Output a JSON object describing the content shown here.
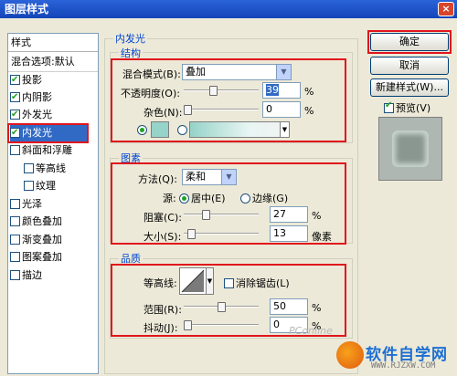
{
  "window": {
    "title": "图层样式",
    "close_label": "×"
  },
  "styles_panel": {
    "header": "样式",
    "blending_options": "混合选项:默认",
    "items": [
      {
        "label": "投影",
        "checked": true
      },
      {
        "label": "内阴影",
        "checked": true
      },
      {
        "label": "外发光",
        "checked": true
      },
      {
        "label": "内发光",
        "checked": true,
        "selected": true
      },
      {
        "label": "斜面和浮雕",
        "checked": false
      },
      {
        "label": "等高线",
        "checked": false,
        "indent": true
      },
      {
        "label": "纹理",
        "checked": false,
        "indent": true
      },
      {
        "label": "光泽",
        "checked": false
      },
      {
        "label": "颜色叠加",
        "checked": false
      },
      {
        "label": "渐变叠加",
        "checked": false
      },
      {
        "label": "图案叠加",
        "checked": false
      },
      {
        "label": "描边",
        "checked": false
      }
    ]
  },
  "inner_glow": {
    "title": "内发光",
    "structure": {
      "title": "结构",
      "blend_mode_label": "混合模式(B):",
      "blend_mode_value": "叠加",
      "opacity_label": "不透明度(O):",
      "opacity_value": "39",
      "opacity_unit": "%",
      "opacity_fraction": 0.39,
      "noise_label": "杂色(N):",
      "noise_value": "0",
      "noise_unit": "%",
      "noise_fraction": 0,
      "glow_color": "#96d3c8"
    },
    "elements": {
      "title": "图素",
      "technique_label": "方法(Q):",
      "technique_value": "柔和",
      "source_label": "源:",
      "source_center": "居中(E)",
      "source_edge": "边缘(G)",
      "choke_label": "阻塞(C):",
      "choke_value": "27",
      "choke_unit": "%",
      "choke_fraction": 0.27,
      "size_label": "大小(S):",
      "size_value": "13",
      "size_unit": "像素",
      "size_fraction": 0.05
    },
    "quality": {
      "title": "品质",
      "contour_label": "等高线:",
      "antialias_label": "消除锯齿(L)",
      "range_label": "范围(R):",
      "range_value": "50",
      "range_unit": "%",
      "range_fraction": 0.5,
      "jitter_label": "抖动(J):",
      "jitter_value": "0",
      "jitter_unit": "%",
      "jitter_fraction": 0
    }
  },
  "buttons": {
    "ok": "确定",
    "cancel": "取消",
    "new_style": "新建样式(W)...",
    "preview": "预览(V)",
    "preview_checked": true
  },
  "watermark": {
    "pc": "PConline",
    "text": "软件自学网",
    "url": "WWW.RJZXW.COM"
  },
  "accent_colors": {
    "highlight_box": "#e0161c",
    "group_title": "#0046d5",
    "selection": "#316ac5"
  }
}
